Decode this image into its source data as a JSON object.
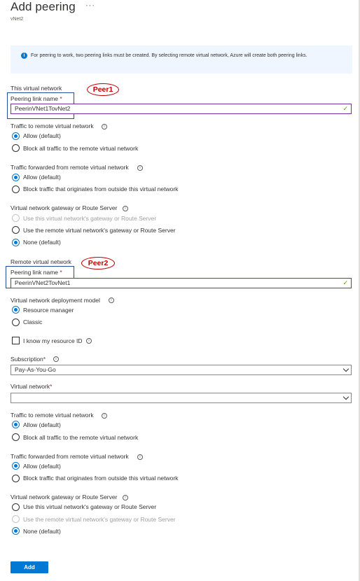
{
  "header": {
    "title": "Add peering",
    "more": "···",
    "subtitle": "vNet2"
  },
  "info": {
    "icon": "i",
    "text": "For peering to work, two peering links must be created. By selecting remote virtual network, Azure will create both peering links."
  },
  "this_network": {
    "section": "This virtual network",
    "annotation": "Peer1",
    "link_name_label": "Peering link name",
    "required": "*",
    "link_name_value": "PeerinVNet1TovNet2",
    "traffic_remote": {
      "label": "Traffic to remote virtual network",
      "options": [
        "Allow (default)",
        "Block all traffic to the remote virtual network"
      ]
    },
    "traffic_forwarded": {
      "label": "Traffic forwarded from remote virtual network",
      "options": [
        "Allow (default)",
        "Block traffic that originates from outside this virtual network"
      ]
    },
    "gateway": {
      "label": "Virtual network gateway or Route Server",
      "options": [
        "Use this virtual network's gateway or Route Server",
        "Use the remote virtual network's gateway or Route Server",
        "None (default)"
      ]
    }
  },
  "remote_network": {
    "section": "Remote virtual network",
    "annotation": "Peer2",
    "link_name_label": "Peering link name",
    "required": "*",
    "link_name_value": "PeerinVNet2TovNet1",
    "deployment": {
      "label": "Virtual network deployment model",
      "options": [
        "Resource manager",
        "Classic"
      ]
    },
    "resource_id_label": "I know my resource ID",
    "subscription": {
      "label": "Subscription",
      "value": "Pay-As-You-Go"
    },
    "virtual_network": {
      "label": "Virtual network",
      "value": ""
    },
    "traffic_remote": {
      "label": "Traffic to remote virtual network",
      "options": [
        "Allow (default)",
        "Block all traffic to the remote virtual network"
      ]
    },
    "traffic_forwarded": {
      "label": "Traffic forwarded from remote virtual network",
      "options": [
        "Allow (default)",
        "Block traffic that originates from outside this virtual network"
      ]
    },
    "gateway": {
      "label": "Virtual network gateway or Route Server",
      "options": [
        "Use this virtual network's gateway or Route Server",
        "Use the remote virtual network's gateway or Route Server",
        "None (default)"
      ]
    }
  },
  "footer": {
    "add_label": "Add"
  },
  "colors": {
    "accent": "#0078d4",
    "annotation": "#c00000",
    "highlight_border": "#7030a0",
    "valid": "#57a300"
  }
}
